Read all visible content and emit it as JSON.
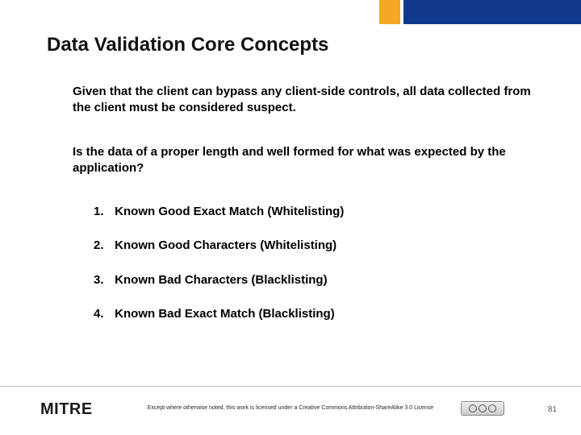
{
  "title": "Data Validation Core Concepts",
  "paragraphs": {
    "p1": "Given that the client can bypass any client-side controls, all data collected from the client must be considered suspect.",
    "p2": "Is the data of a proper length and well formed for what was expected by the application?"
  },
  "list": {
    "items": {
      "i1": {
        "num": "1.",
        "text": "Known Good Exact Match (Whitelisting)"
      },
      "i2": {
        "num": "2.",
        "text": "Known Good Characters (Whitelisting)"
      },
      "i3": {
        "num": "3.",
        "text": "Known Bad Characters (Blacklisting)"
      },
      "i4": {
        "num": "4.",
        "text": "Known Bad Exact Match (Blacklisting)"
      }
    }
  },
  "footer": {
    "org": "MITRE",
    "license": "Except where otherwise noted, this work is licensed under a Creative Commons Attribution-ShareAlike 3.0 License",
    "page": "81"
  }
}
